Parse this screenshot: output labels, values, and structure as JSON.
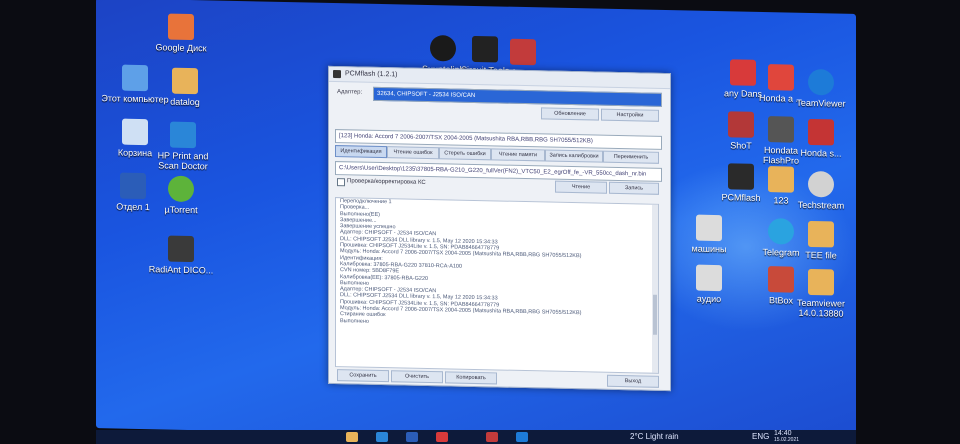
{
  "desktop_icons_left": [
    {
      "label": "Google Диск",
      "color": "#e8733a"
    },
    {
      "label": "Этот компьютер",
      "color": "#5ea0e8"
    },
    {
      "label": "datalog",
      "color": "#e8b35a"
    },
    {
      "label": "Корзина",
      "color": "#cfe0f4"
    },
    {
      "label": "HP Print and Scan Doctor",
      "color": "#2a86d8"
    },
    {
      "label": "Отдел 1",
      "color": "#2b5db8"
    },
    {
      "label": "µTorrent",
      "color": "#5db33a"
    },
    {
      "label": "RadiAnt DICO...",
      "color": "#3a3a3a"
    }
  ],
  "desktop_icons_top": [
    {
      "label": "Suuntolink",
      "color": "#1a1a1a"
    },
    {
      "label": "Circuit Tools",
      "color": "#222222"
    },
    {
      "label": "Performan...",
      "color": "#c23b3b"
    }
  ],
  "desktop_icons_right": [
    {
      "label": "any Dans",
      "color": "#d83a3a"
    },
    {
      "label": "Honda a ...",
      "color": "#e0463c"
    },
    {
      "label": "TeamViewer",
      "color": "#1d7bd8"
    },
    {
      "label": "ShoT",
      "color": "#b33838"
    },
    {
      "label": "Hondata FlashPro",
      "color": "#555555"
    },
    {
      "label": "Honda s...",
      "color": "#c43434"
    },
    {
      "label": "PCMflash",
      "color": "#2a2a2a"
    },
    {
      "label": "123",
      "color": "#e8b35a"
    },
    {
      "label": "Techstream",
      "color": "#d2d2d2"
    },
    {
      "label": "Telegram",
      "color": "#2aa3e0"
    },
    {
      "label": "TEE file",
      "color": "#e8b35a"
    },
    {
      "label": "BtBox",
      "color": "#c84a3a"
    },
    {
      "label": "Teamviewer 14.0.13880",
      "color": "#e8b35a"
    },
    {
      "label": "машины",
      "color": "#dcdcdc"
    },
    {
      "label": "аудио",
      "color": "#dcdcdc"
    }
  ],
  "window": {
    "title": "PCMflash (1.2.1)",
    "adapter_label": "Адаптер:",
    "adapter_value": "32634, CHIPSOFT - J2534 ISO/CAN",
    "btn_update": "Обновление",
    "btn_settings": "Настройки",
    "protocol_value": "[123] Honda: Accord 7 2006-2007/TSX 2004-2005 (Matsushita RBA,RBB,RBG SH7055/512KB)",
    "tabs": [
      "Идентификация",
      "Чтение ошибок",
      "Стереть ошибки",
      "Чтение памяти",
      "Запись калибровки",
      "Переименить"
    ],
    "file_path": "C:\\Users\\User\\Desktop\\1235\\37805-RBA-G210_G220_fullVer(FN2)_VTC50_E2_egrOff_fe_-VR_550cc_dash_nr.bin",
    "checkbox_label": "Проверка/корректировка КС",
    "btn_read": "Чтение",
    "btn_write": "Запись",
    "log_lines": [
      "Переподключение 1",
      "Проверка...",
      "Выполнено(ЕЕ)",
      "Завершение...",
      "Завершение успешно",
      "Адаптер: CHIPSOFT - J2534 ISO/CAN",
      "DLL: CHIPSOFT J2534 DLL library v. 1.5, May 12 2020 15:34:33",
      "Прошивка: CHIPSOFT J2534Lite v. 1.5, SN: PDAB84664778779",
      "Модуль: Honda: Accord 7 2006-2007/TSX 2004-2005 (Matsushita RBA,RBB,RBG SH7055/512KB)",
      "Идентификация:",
      "Калибровка:          37805-RBA-G220  37810-RCA-A100",
      "CVN номер:           5BD8F79E",
      "Калибровка(EE):      37805-RBA-G220",
      "Выполнено",
      "",
      "Адаптер: CHIPSOFT - J2534 ISO/CAN",
      "DLL: CHIPSOFT J2534 DLL library v. 1.5, May 12 2020 15:34:33",
      "Прошивка: CHIPSOFT J2534Lite v. 1.5, SN: PDAB84664778779",
      "Модуль: Honda: Accord 7 2006-2007/TSX 2004-2005 (Matsushita RBA,RBB,RBG SH7055/512KB)",
      "Стирание ошибок",
      "Выполнено"
    ],
    "bottom_buttons": [
      "Сохранить",
      "Очистить",
      "Копировать",
      "Выход"
    ]
  },
  "taskbar": {
    "weather": "2°C  Light rain",
    "lang": "ENG",
    "time": "14:40",
    "date": "15.02.2021"
  }
}
